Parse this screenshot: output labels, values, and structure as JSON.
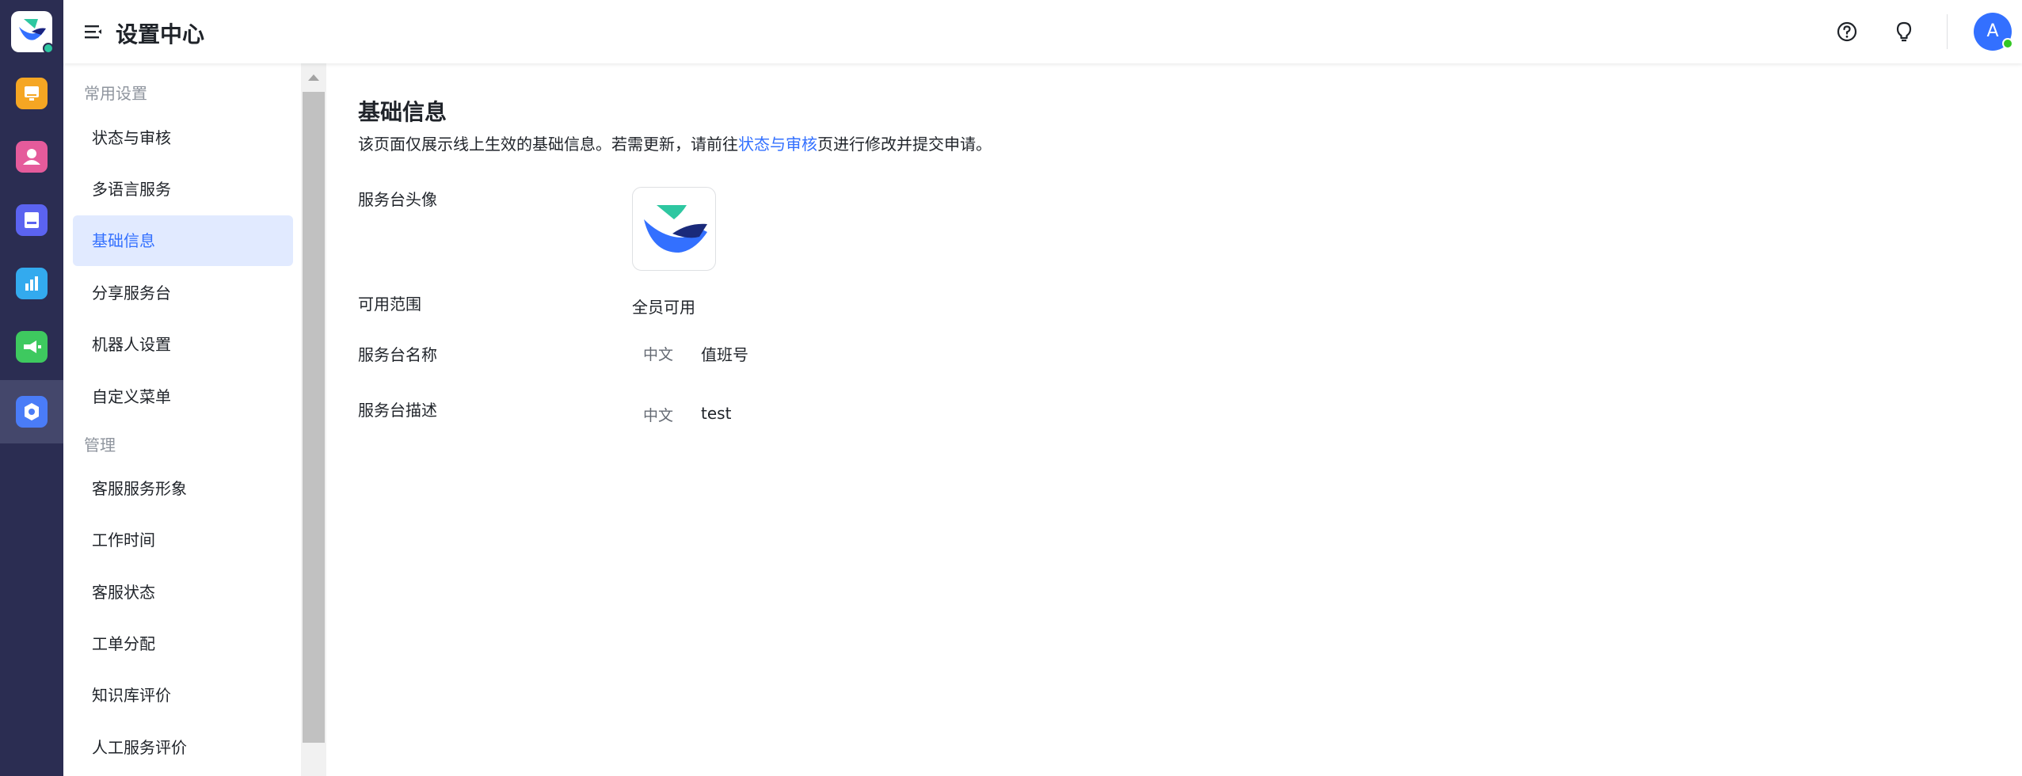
{
  "header": {
    "title": "设置中心",
    "avatar_initial": "A"
  },
  "rail": {
    "colors": [
      "#f5a623",
      "#e55b9b",
      "#5b63f0",
      "#33aaee",
      "#3ec95f",
      "#4a7cf7"
    ],
    "icons": [
      "monitor-icon",
      "person-icon",
      "book-icon",
      "bar-chart-icon",
      "megaphone-icon",
      "settings-gear-icon"
    ]
  },
  "sidebar": {
    "group1_title": "常用设置",
    "group2_title": "管理",
    "items": [
      {
        "label": "状态与审核"
      },
      {
        "label": "多语言服务"
      },
      {
        "label": "基础信息"
      },
      {
        "label": "分享服务台"
      },
      {
        "label": "机器人设置"
      },
      {
        "label": "自定义菜单"
      },
      {
        "label": "客服服务形象"
      },
      {
        "label": "工作时间"
      },
      {
        "label": "客服状态"
      },
      {
        "label": "工单分配"
      },
      {
        "label": "知识库评价"
      },
      {
        "label": "人工服务评价"
      }
    ]
  },
  "main": {
    "title": "基础信息",
    "desc_prefix": "该页面仅展示线上生效的基础信息。若需更新，请前往",
    "desc_link": "状态与审核",
    "desc_suffix": "页进行修改并提交申请。",
    "fields": {
      "avatar_label": "服务台头像",
      "scope_label": "可用范围",
      "scope_value": "全员可用",
      "name_label": "服务台名称",
      "name_lang": "中文",
      "name_value": "值班号",
      "desc_label": "服务台描述",
      "desc_lang": "中文",
      "desc_value": "test"
    }
  }
}
